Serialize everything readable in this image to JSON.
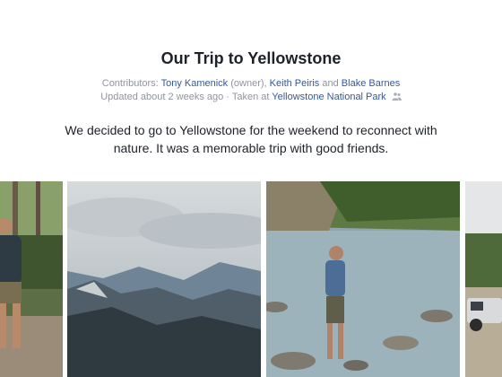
{
  "album": {
    "title": "Our Trip to Yellowstone",
    "contributors_prefix": "Contributors:",
    "contributors": [
      {
        "name": "Tony Kamenick",
        "role": "(owner)"
      },
      {
        "name": "Keith Peiris"
      },
      {
        "name": "Blake Barnes"
      }
    ],
    "separator_comma": ",",
    "separator_and": "and",
    "updated_text": "Updated about 2 weeks ago",
    "dot": "·",
    "taken_at_label": "Taken at",
    "location": "Yellowstone National Park",
    "description": "We decided to go to Yellowstone for the weekend to reconnect with nature. It was a memorable trip with good friends."
  },
  "icons": {
    "location_people": "people-icon"
  },
  "colors": {
    "link": "#365899",
    "meta_text": "#90949c",
    "body_text": "#1d2129"
  }
}
